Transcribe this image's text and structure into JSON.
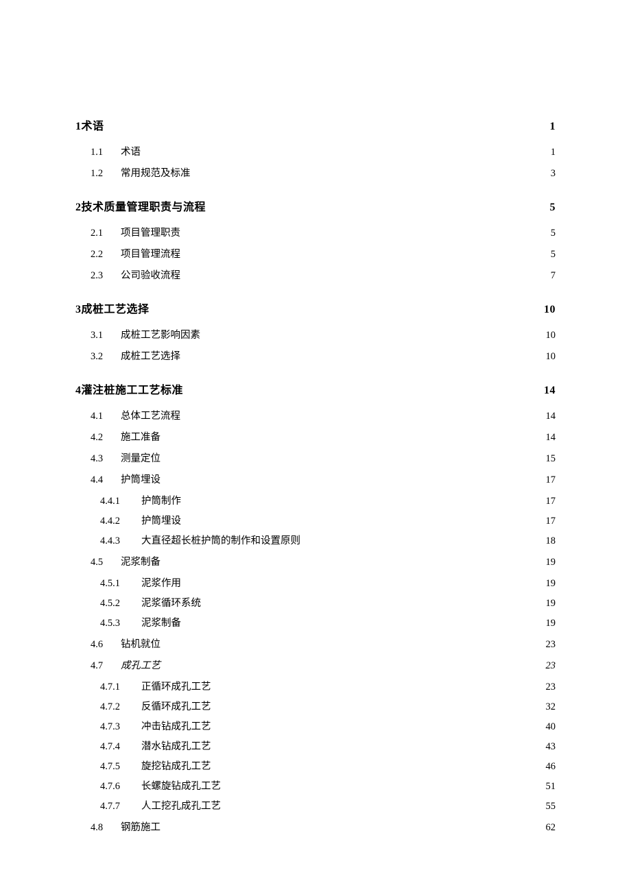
{
  "toc": [
    {
      "level": 0,
      "first": true,
      "num": "1",
      "title": "术语",
      "page": "1"
    },
    {
      "level": 1,
      "num": "1.1",
      "title": "术语",
      "page": "1"
    },
    {
      "level": 1,
      "num": "1.2",
      "title": "常用规范及标准",
      "page": "3"
    },
    {
      "level": 0,
      "num": "2",
      "title": "技术质量管理职责与流程",
      "page": "5"
    },
    {
      "level": 1,
      "num": "2.1",
      "title": "项目管理职责",
      "page": "5"
    },
    {
      "level": 1,
      "num": "2.2",
      "title": "项目管理流程",
      "page": "5"
    },
    {
      "level": 1,
      "num": "2.3",
      "title": "公司验收流程",
      "page": "7"
    },
    {
      "level": 0,
      "num": "3",
      "title": "成桩工艺选择",
      "page": "10"
    },
    {
      "level": 1,
      "num": "3.1",
      "title": "成桩工艺影响因素",
      "page": "10"
    },
    {
      "level": 1,
      "num": "3.2",
      "title": "成桩工艺选择",
      "page": "10"
    },
    {
      "level": 0,
      "num": "4",
      "title": "灌注桩施工工艺标准",
      "page": "14"
    },
    {
      "level": 1,
      "num": "4.1",
      "title": "总体工艺流程",
      "page": "14"
    },
    {
      "level": 1,
      "num": "4.2",
      "title": "施工准备",
      "page": "14"
    },
    {
      "level": 1,
      "num": "4.3",
      "title": "测量定位",
      "page": "15"
    },
    {
      "level": 1,
      "num": "4.4",
      "title": "护筒埋设",
      "page": "17"
    },
    {
      "level": 2,
      "num": "4.4.1",
      "title": "护筒制作",
      "page": "17"
    },
    {
      "level": 2,
      "num": "4.4.2",
      "title": "护筒埋设",
      "page": "17"
    },
    {
      "level": 2,
      "num": "4.4.3",
      "title": "大直径超长桩护筒的制作和设置原则",
      "page": "18"
    },
    {
      "level": 1,
      "num": "4.5",
      "title": "泥浆制备",
      "page": "19"
    },
    {
      "level": 2,
      "num": "4.5.1",
      "title": "泥浆作用",
      "page": "19"
    },
    {
      "level": 2,
      "num": "4.5.2",
      "title": "泥浆循环系统",
      "page": "19"
    },
    {
      "level": 2,
      "num": "4.5.3",
      "title": "泥浆制备",
      "page": "19"
    },
    {
      "level": 1,
      "num": "4.6",
      "title": "钻机就位",
      "page": "23"
    },
    {
      "level": 1,
      "italic": true,
      "num": "4.7",
      "title": "成孔工艺",
      "page": "23"
    },
    {
      "level": 2,
      "num": "4.7.1",
      "title": "正循环成孔工艺",
      "page": "23"
    },
    {
      "level": 2,
      "num": "4.7.2",
      "title": "反循环成孔工艺",
      "page": "32"
    },
    {
      "level": 2,
      "num": "4.7.3",
      "title": "冲击钻成孔工艺",
      "page": "40"
    },
    {
      "level": 2,
      "num": "4.7.4",
      "title": "潜水钻成孔工艺",
      "page": "43"
    },
    {
      "level": 2,
      "num": "4.7.5",
      "title": "旋挖钻成孔工艺",
      "page": "46"
    },
    {
      "level": 2,
      "num": "4.7.6",
      "title": "长螺旋钻成孔工艺",
      "page": "51"
    },
    {
      "level": 2,
      "num": "4.7.7",
      "title": "人工挖孔成孔工艺",
      "page": "55"
    },
    {
      "level": 1,
      "num": "4.8",
      "title": "钢筋施工",
      "page": "62"
    }
  ]
}
